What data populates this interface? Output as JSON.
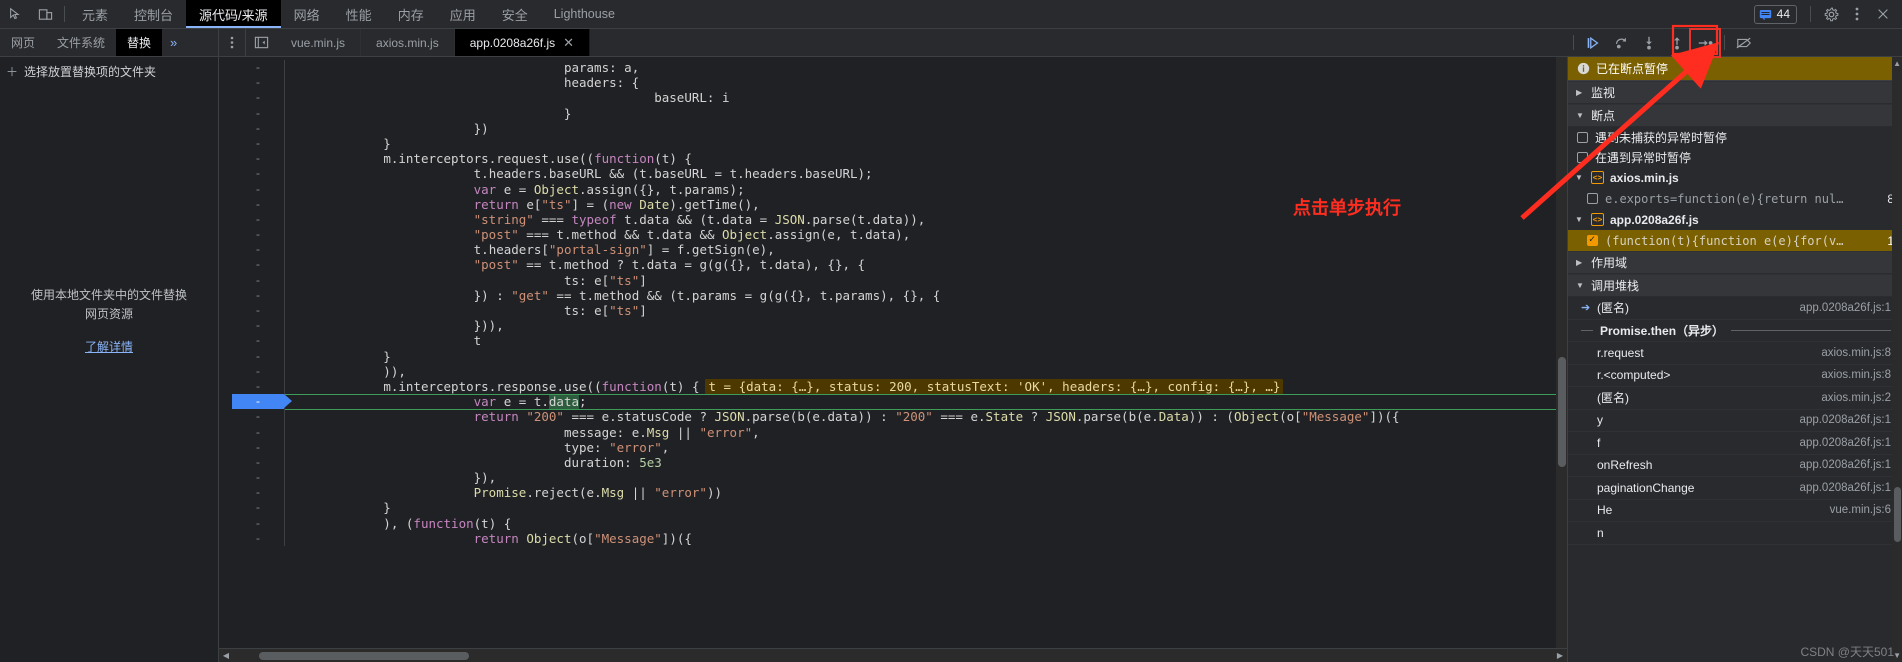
{
  "window": {
    "issues_count": "44"
  },
  "main_tabs": [
    {
      "label": "元素",
      "active": false
    },
    {
      "label": "控制台",
      "active": false
    },
    {
      "label": "源代码/来源",
      "active": true
    },
    {
      "label": "网络",
      "active": false
    },
    {
      "label": "性能",
      "active": false
    },
    {
      "label": "内存",
      "active": false
    },
    {
      "label": "应用",
      "active": false
    },
    {
      "label": "安全",
      "active": false
    },
    {
      "label": "Lighthouse",
      "active": false
    }
  ],
  "nav_tabs": [
    {
      "label": "网页",
      "active": false
    },
    {
      "label": "文件系统",
      "active": false
    },
    {
      "label": "替换",
      "active": true
    }
  ],
  "nav_more_label": "»",
  "editor_tabs": [
    {
      "label": "vue.min.js",
      "active": false,
      "closable": false
    },
    {
      "label": "axios.min.js",
      "active": false,
      "closable": false
    },
    {
      "label": "app.0208a26f.js",
      "active": true,
      "closable": true
    }
  ],
  "navigator": {
    "add_folder_label": "选择放置替换项的文件夹",
    "empty_text_line1": "使用本地文件夹中的文件替换",
    "empty_text_line2": "网页资源",
    "learn_more": "了解详情"
  },
  "debug_toolbar": {
    "resume_title": "resume-icon",
    "step_over_title": "step-over-icon",
    "step_into_title": "step-into-icon",
    "step_out_title": "step-out-icon",
    "step_title": "step-icon",
    "deactivate_title": "deactivate-breakpoints-icon",
    "highlight_color": "#e8342a"
  },
  "debug": {
    "paused_banner": "已在断点暂停",
    "watch_section": "监视",
    "breakpoints_section": "断点",
    "pause_uncaught": "遇到未捕获的异常时暂停",
    "pause_caught": "在遇到异常时暂停",
    "scope_section": "作用域",
    "callstack_section": "调用堆栈",
    "breakpoint_files": [
      {
        "file": "axios.min.js",
        "items": [
          {
            "checked": false,
            "snippet": "e.exports=function(e){return nul…",
            "line": "8",
            "selected": false
          }
        ]
      },
      {
        "file": "app.0208a26f.js",
        "items": [
          {
            "checked": true,
            "snippet": "(function(t){function e(e){for(v…",
            "line": "1",
            "selected": true
          }
        ]
      }
    ],
    "callstack": [
      {
        "name": "(匿名)",
        "location": "app.0208a26f.js:1",
        "current": true,
        "async_divider": false
      },
      {
        "name": "Promise.then（异步）",
        "location": "",
        "current": false,
        "async_divider": true
      },
      {
        "name": "r.request",
        "location": "axios.min.js:8",
        "current": false,
        "async_divider": false
      },
      {
        "name": "r.<computed>",
        "location": "axios.min.js:8",
        "current": false,
        "async_divider": false
      },
      {
        "name": "(匿名)",
        "location": "axios.min.js:2",
        "current": false,
        "async_divider": false
      },
      {
        "name": "y",
        "location": "app.0208a26f.js:1",
        "current": false,
        "async_divider": false
      },
      {
        "name": "f",
        "location": "app.0208a26f.js:1",
        "current": false,
        "async_divider": false
      },
      {
        "name": "onRefresh",
        "location": "app.0208a26f.js:1",
        "current": false,
        "async_divider": false
      },
      {
        "name": "paginationChange",
        "location": "app.0208a26f.js:1",
        "current": false,
        "async_divider": false
      },
      {
        "name": "He",
        "location": "vue.min.js:6",
        "current": false,
        "async_divider": false
      },
      {
        "name": "n",
        "location": "",
        "current": false,
        "async_divider": false
      }
    ]
  },
  "annotation": {
    "text": "点击单步执行",
    "color": "#ff2d20"
  },
  "watermark": "CSDN @天天501",
  "code": {
    "inline_eval": "t = {data: {…}, status: 200, statusText: 'OK', headers: {…}, config: {…}, …}",
    "lines": [
      {
        "gutter": "-",
        "indent": 12,
        "text": "params: a,"
      },
      {
        "gutter": "-",
        "indent": 12,
        "text": "headers: {"
      },
      {
        "gutter": "-",
        "indent": 16,
        "text": "baseURL: i"
      },
      {
        "gutter": "-",
        "indent": 12,
        "text": "}"
      },
      {
        "gutter": "-",
        "indent": 8,
        "text": "})"
      },
      {
        "gutter": "-",
        "indent": 4,
        "text": "}"
      },
      {
        "gutter": "-",
        "indent": 4,
        "text": "m.interceptors.request.use((function(t) {"
      },
      {
        "gutter": "-",
        "indent": 8,
        "text": "t.headers.baseURL && (t.baseURL = t.headers.baseURL);"
      },
      {
        "gutter": "-",
        "indent": 8,
        "text": "var e = Object.assign({}, t.params);"
      },
      {
        "gutter": "-",
        "indent": 8,
        "text": "return e[\"ts\"] = (new Date).getTime(),"
      },
      {
        "gutter": "-",
        "indent": 8,
        "text": "\"string\" === typeof t.data && (t.data = JSON.parse(t.data)),"
      },
      {
        "gutter": "-",
        "indent": 8,
        "text": "\"post\" === t.method && t.data && Object.assign(e, t.data),"
      },
      {
        "gutter": "-",
        "indent": 8,
        "text": "t.headers[\"portal-sign\"] = f.getSign(e),"
      },
      {
        "gutter": "-",
        "indent": 8,
        "text": "\"post\" == t.method ? t.data = g(g({}, t.data), {}, {"
      },
      {
        "gutter": "-",
        "indent": 12,
        "text": "ts: e[\"ts\"]"
      },
      {
        "gutter": "-",
        "indent": 8,
        "text": "}) : \"get\" == t.method && (t.params = g(g({}, t.params), {}, {"
      },
      {
        "gutter": "-",
        "indent": 12,
        "text": "ts: e[\"ts\"]"
      },
      {
        "gutter": "-",
        "indent": 8,
        "text": "})),"
      },
      {
        "gutter": "-",
        "indent": 8,
        "text": "t"
      },
      {
        "gutter": "-",
        "indent": 4,
        "text": "}"
      },
      {
        "gutter": "-",
        "indent": 4,
        "text": ")),"
      },
      {
        "gutter": "-",
        "indent": 4,
        "text": "m.interceptors.response.use((function(t) {"
      },
      {
        "gutter": "-",
        "indent": 8,
        "text": "var e = t.data;",
        "current": true
      },
      {
        "gutter": "-",
        "indent": 8,
        "text": "return \"200\" === e.statusCode ? JSON.parse(b(e.data)) : \"200\" === e.State ? JSON.parse(b(e.Data)) : (Object(o[\"Message\"])({"
      },
      {
        "gutter": "-",
        "indent": 12,
        "text": "message: e.Msg || \"error\","
      },
      {
        "gutter": "-",
        "indent": 12,
        "text": "type: \"error\","
      },
      {
        "gutter": "-",
        "indent": 12,
        "text": "duration: 5e3"
      },
      {
        "gutter": "-",
        "indent": 8,
        "text": "}),"
      },
      {
        "gutter": "-",
        "indent": 8,
        "text": "Promise.reject(e.Msg || \"error\"))"
      },
      {
        "gutter": "-",
        "indent": 4,
        "text": "}"
      },
      {
        "gutter": "-",
        "indent": 4,
        "text": "), (function(t) {"
      },
      {
        "gutter": "-",
        "indent": 8,
        "text": "return Object(o[\"Message\"])({"
      }
    ]
  }
}
